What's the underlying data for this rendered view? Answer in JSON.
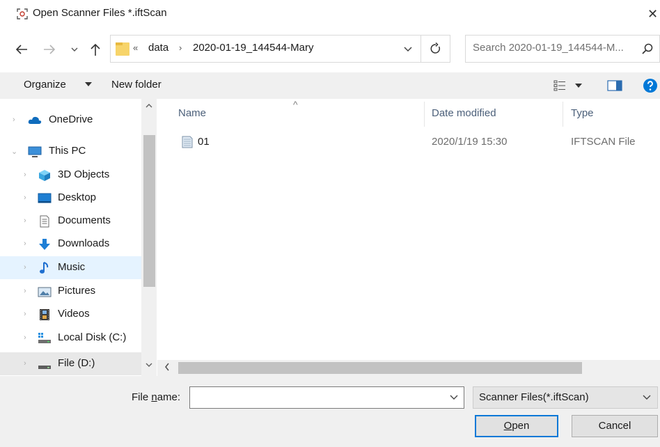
{
  "window": {
    "title": "Open Scanner Files *.iftScan",
    "title_icon": "scanner-app-icon",
    "close_glyph": "✕"
  },
  "nav": {
    "back_icon": "arrow-left-icon",
    "forward_icon": "arrow-right-icon",
    "recent_icon": "chevron-down-icon",
    "up_icon": "arrow-up-icon"
  },
  "address": {
    "overflow_glyph": "«",
    "separator_glyph": "›",
    "crumbs": [
      "data",
      "2020-01-19_144544-Mary"
    ]
  },
  "search": {
    "placeholder": "Search 2020-01-19_144544-M..."
  },
  "toolbar": {
    "organize_label": "Organize",
    "new_folder_label": "New folder"
  },
  "sidebar": {
    "items": [
      {
        "label": "OneDrive",
        "icon": "cloud-icon",
        "chevron": "›"
      },
      {
        "label": "This PC",
        "icon": "monitor-icon",
        "chevron": "⌄"
      },
      {
        "label": "3D Objects",
        "icon": "cube-icon",
        "chevron": "›"
      },
      {
        "label": "Desktop",
        "icon": "desktop-icon",
        "chevron": "›"
      },
      {
        "label": "Documents",
        "icon": "document-icon",
        "chevron": "›"
      },
      {
        "label": "Downloads",
        "icon": "download-arrow-icon",
        "chevron": "›"
      },
      {
        "label": "Music",
        "icon": "music-note-icon",
        "chevron": "›"
      },
      {
        "label": "Pictures",
        "icon": "picture-icon",
        "chevron": "›"
      },
      {
        "label": "Videos",
        "icon": "film-icon",
        "chevron": "›"
      },
      {
        "label": "Local Disk (C:)",
        "icon": "windows-drive-icon",
        "chevron": "›"
      },
      {
        "label": "File (D:)",
        "icon": "drive-icon",
        "chevron": "›"
      }
    ]
  },
  "file_list": {
    "sort_glyph": "^",
    "columns": [
      "Name",
      "Date modified",
      "Type"
    ],
    "rows": [
      {
        "name": "01",
        "date_modified": "2020/1/19 15:30",
        "type": "IFTSCAN File",
        "icon": "file-icon"
      }
    ]
  },
  "footer": {
    "file_name_label_prefix": "File ",
    "file_name_label_underlined": "n",
    "file_name_label_suffix": "ame:",
    "file_name_value": "",
    "filter_value": "Scanner Files(*.iftScan)",
    "open_label_underlined": "O",
    "open_label_suffix": "pen",
    "cancel_label": "Cancel"
  },
  "colors": {
    "accent": "#0078d7",
    "selected_bg": "#e5f3ff",
    "toolbar_bg": "#f0f0f0"
  }
}
